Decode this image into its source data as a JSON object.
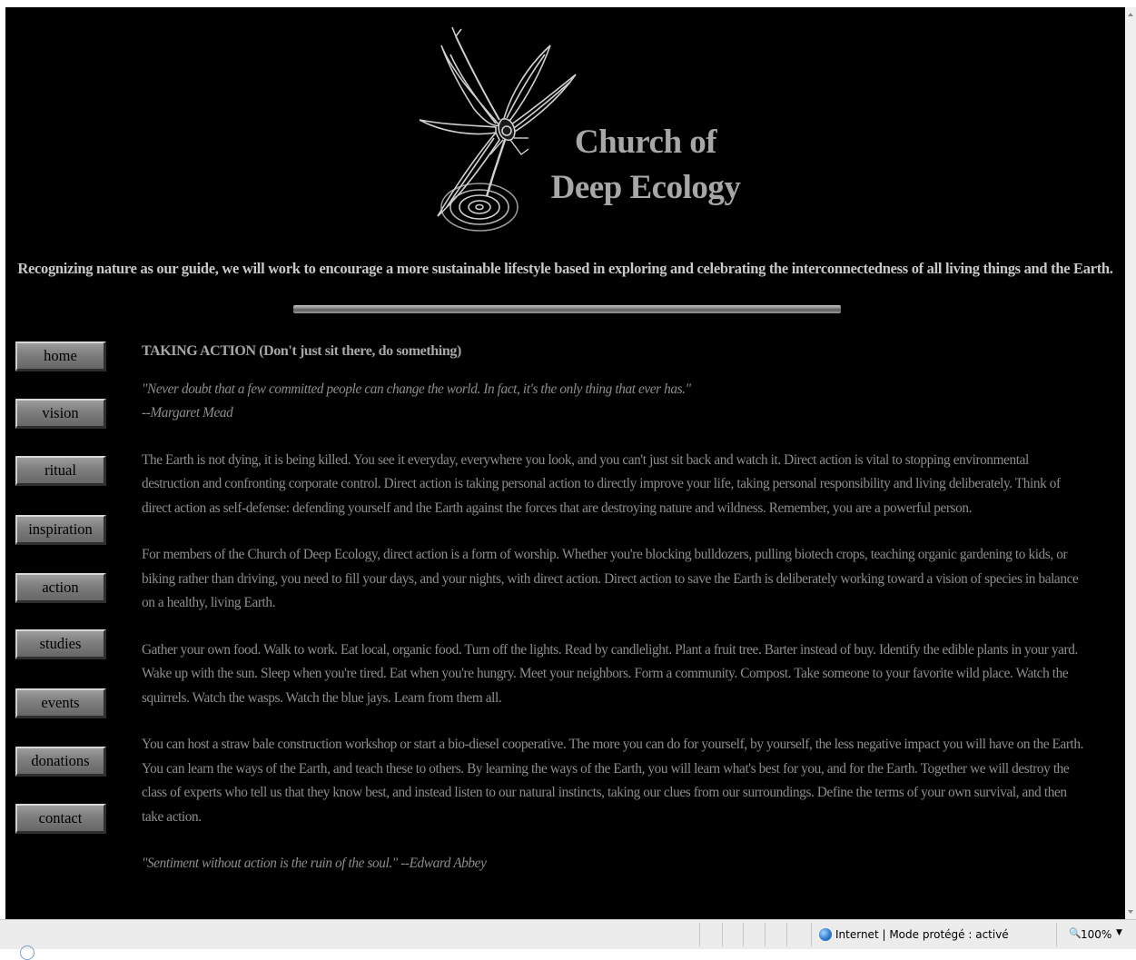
{
  "site": {
    "title_line1": "Church of",
    "title_line2": "Deep Ecology",
    "tagline": "Recognizing nature as our guide, we will work to encourage a more sustainable lifestyle based in exploring and celebrating the interconnectedness of all living things and the Earth."
  },
  "nav": {
    "items": [
      {
        "label": "home"
      },
      {
        "label": "vision"
      },
      {
        "label": "ritual"
      },
      {
        "label": "inspiration"
      },
      {
        "label": "action"
      },
      {
        "label": "studies"
      },
      {
        "label": "events"
      },
      {
        "label": "donations"
      },
      {
        "label": "contact"
      }
    ]
  },
  "content": {
    "heading": "TAKING ACTION (Don't just sit there, do something)",
    "quote_text": "\"Never doubt that a few committed people can change the world. In fact, it's the only thing that ever has.\"",
    "quote_author": "--Margaret Mead",
    "paragraphs": [
      "The Earth is not dying, it is being killed. You see it everyday, everywhere you look, and you can't just sit back and watch it. Direct action is vital to stopping environmental destruction and confronting corporate control. Direct action is taking personal action to directly improve your life, taking personal responsibility and living deliberately. Think of direct action as self-defense: defending yourself and the Earth against the forces that are destroying nature and wildness. Remember, you are a powerful person.",
      "For members of the Church of Deep Ecology, direct action is a form of worship. Whether you're blocking bulldozers, pulling biotech crops, teaching organic gardening to kids, or biking rather than driving, you need to fill your days, and your nights, with direct action. Direct action to save the Earth is deliberately working toward a vision of species in balance on a healthy, living Earth.",
      "Gather your own food. Walk to work. Eat local, organic food. Turn off the lights. Read by candlelight. Plant a fruit tree. Barter instead of buy. Identify the edible plants in your yard. Wake up with the sun. Sleep when you're tired. Eat when you're hungry. Meet your neighbors. Form a community. Compost. Take someone to your favorite wild place. Watch the squirrels. Watch the wasps. Watch the blue jays. Learn from them all.",
      "You can host a straw bale construction workshop or start a bio-diesel cooperative. The more you can do for yourself, by yourself, the less negative impact you will have on the Earth. You can learn the ways of the Earth, and teach these to others. By learning the ways of the Earth, you will learn what's best for you, and for the Earth. Together we will destroy the class of experts who tell us that they know best, and instead listen to our natural instincts, taking our clues from our surroundings. Define the terms of your own survival, and then take action."
    ],
    "final_quote": "\"Sentiment without action is the ruin of the soul.\" --Edward Abbey"
  },
  "statusbar": {
    "zone": "Internet | Mode protégé : activé",
    "zoom": "100%"
  },
  "colors": {
    "page_background": "#000000",
    "title_text": "#a7a7a7",
    "body_text": "#8d8d8d",
    "nav_button": "#808080"
  },
  "icons": {
    "logo": "dragonfly-logo-icon",
    "zone": "globe-icon",
    "zoom": "magnifier-icon"
  }
}
